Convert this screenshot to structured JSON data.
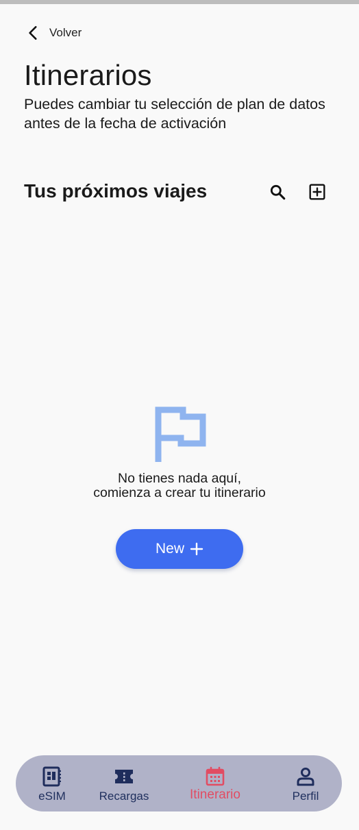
{
  "header": {
    "back_label": "Volver",
    "title": "Itinerarios",
    "subtitle": "Puedes cambiar tu selección de plan de datos antes de la fecha de activación"
  },
  "section": {
    "title": "Tus próximos viajes"
  },
  "empty_state": {
    "icon": "flag-icon",
    "line1": "No tienes nada aquí,",
    "line2": "comienza a crear tu itinerario"
  },
  "new_button": {
    "label": "New"
  },
  "bottom_nav": {
    "items": [
      {
        "label": "eSIM",
        "icon": "esim-icon"
      },
      {
        "label": "Recargas",
        "icon": "ticket-icon"
      },
      {
        "label": "Itinerario",
        "icon": "calendar-icon",
        "active": true
      },
      {
        "label": "Perfil",
        "icon": "person-icon"
      }
    ]
  },
  "colors": {
    "background": "#f9f9f9",
    "accent": "#3e6cf0",
    "flag": "#8fb4ef",
    "nav_background": "#b0b2c8",
    "nav_icon": "#1f2d5c",
    "nav_active": "#e14d63"
  }
}
